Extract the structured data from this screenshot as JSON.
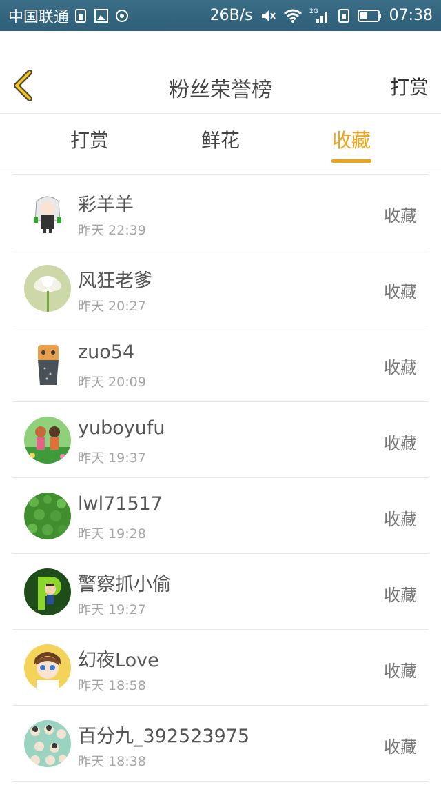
{
  "status_bar": {
    "carrier": "中国联通",
    "speed": "26B/s",
    "network": "2G",
    "time": "07:38"
  },
  "header": {
    "title": "粉丝荣誉榜",
    "right_action": "打赏"
  },
  "tabs": [
    {
      "label": "打赏"
    },
    {
      "label": "鲜花"
    },
    {
      "label": "收藏"
    }
  ],
  "active_tab": "收藏",
  "accent_color": "#f1a316",
  "fans": [
    {
      "name": "彩羊羊",
      "time": "昨天 22:39",
      "action": "收藏"
    },
    {
      "name": "风狂老爹",
      "time": "昨天 20:27",
      "action": "收藏"
    },
    {
      "name": "zuo54",
      "time": "昨天 20:09",
      "action": "收藏"
    },
    {
      "name": "yuboyufu",
      "time": "昨天 19:37",
      "action": "收藏"
    },
    {
      "name": "lwl71517",
      "time": "昨天 19:28",
      "action": "收藏"
    },
    {
      "name": "警察抓小偷",
      "time": "昨天 19:27",
      "action": "收藏"
    },
    {
      "name": "幻夜Love",
      "time": "昨天 18:58",
      "action": "收藏"
    },
    {
      "name": "百分九_392523975",
      "time": "昨天 18:38",
      "action": "收藏"
    }
  ]
}
